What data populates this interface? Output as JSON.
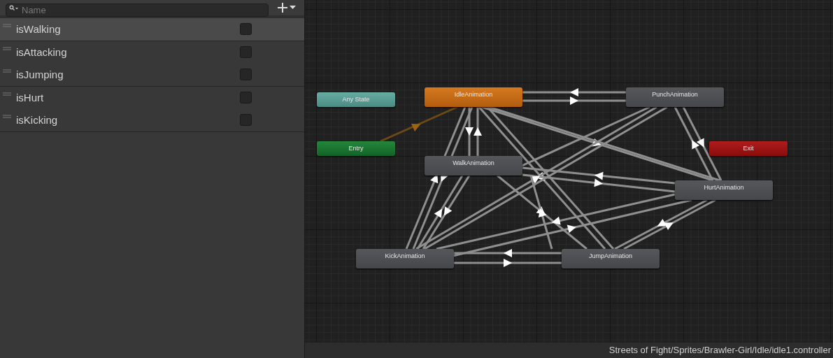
{
  "parameters": {
    "search": {
      "placeholder": "Name"
    },
    "items": [
      {
        "name": "isWalking",
        "selected": true,
        "checked": false
      },
      {
        "name": "isAttacking",
        "selected": false,
        "checked": false
      },
      {
        "name": "isJumping",
        "selected": false,
        "checked": false
      },
      {
        "name": "isHurt",
        "selected": false,
        "checked": false
      },
      {
        "name": "isKicking",
        "selected": false,
        "checked": false
      }
    ]
  },
  "graph": {
    "nodes": [
      {
        "label": "Any State",
        "kind": "any"
      },
      {
        "label": "IdleAnimation",
        "kind": "default"
      },
      {
        "label": "PunchAnimation",
        "kind": "state"
      },
      {
        "label": "Entry",
        "kind": "entry"
      },
      {
        "label": "Exit",
        "kind": "exit"
      },
      {
        "label": "WalkAnimation",
        "kind": "state"
      },
      {
        "label": "HurtAnimation",
        "kind": "state"
      },
      {
        "label": "KickAnimation",
        "kind": "state"
      },
      {
        "label": "JumpAnimation",
        "kind": "state"
      }
    ]
  },
  "status_bar": {
    "path": "Streets of Fight/Sprites/Brawler-Girl/Idle/idle1.controller"
  }
}
